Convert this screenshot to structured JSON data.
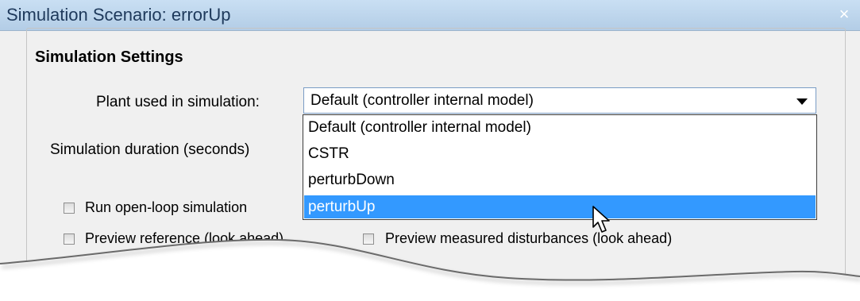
{
  "window": {
    "title": "Simulation Scenario: errorUp",
    "close_glyph": "×"
  },
  "group": {
    "title": "Simulation Settings"
  },
  "plant": {
    "label": "Plant used in simulation:",
    "selected_value": "Default (controller internal model)",
    "options": [
      "Default (controller internal model)",
      "CSTR",
      "perturbDown",
      "perturbUp"
    ],
    "highlighted_option": "perturbUp"
  },
  "duration": {
    "label": "Simulation duration (seconds)"
  },
  "checkboxes": {
    "open_loop": "Run open-loop simulation",
    "preview_reference": "Preview reference (look ahead)",
    "preview_disturbances": "Preview measured disturbances (look ahead)"
  },
  "colors": {
    "titlebar": "#b3cde6",
    "title_text": "#1e395b",
    "selection": "#3399ff",
    "dialog_bg": "#f0f0f0"
  },
  "icons": [
    "close-icon",
    "dropdown-arrow-icon",
    "mouse-pointer-icon"
  ]
}
